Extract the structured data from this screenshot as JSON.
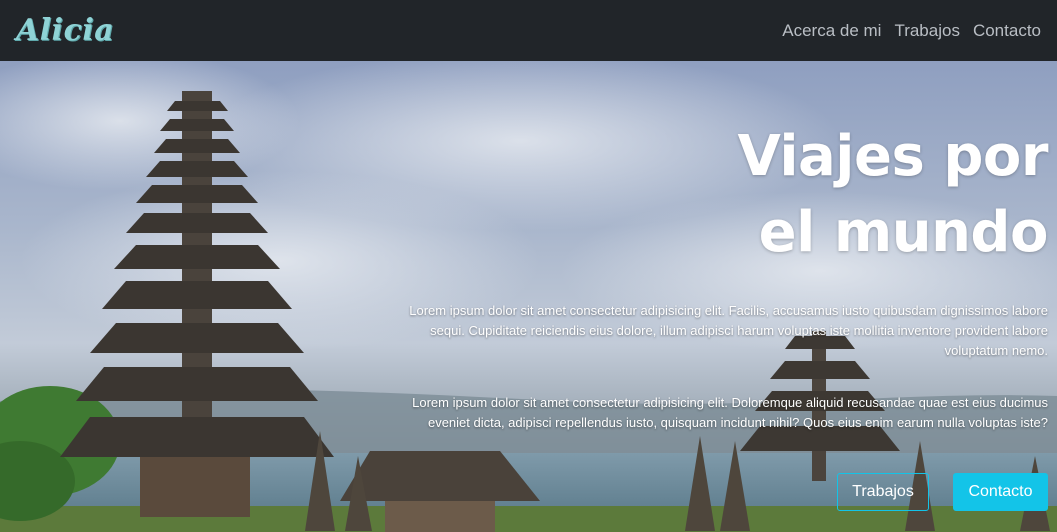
{
  "brand": {
    "logo_text": "Alicia"
  },
  "nav": {
    "items": [
      {
        "label": "Acerca de mi"
      },
      {
        "label": "Trabajos"
      },
      {
        "label": "Contacto"
      }
    ]
  },
  "hero": {
    "title_line1": "Viajes por",
    "title_line2": "el mundo",
    "paragraph1": "Lorem ipsum dolor sit amet consectetur adipisicing elit. Facilis, accusamus iusto quibusdam dignissimos labore sequi. Cupiditate reiciendis eius dolore, illum adipisci harum voluptas iste mollitia inventore provident labore voluptatum nemo.",
    "paragraph2": "Lorem ipsum dolor sit amet consectetur adipisicing elit. Doloremque aliquid recusandae quae est eius ducimus eveniet dicta, adipisci repellendus iusto, quisquam incidunt nihil? Quos eius enim earum nulla voluptas iste?",
    "buttons": {
      "works_label": "Trabajos",
      "contact_label": "Contacto"
    }
  },
  "colors": {
    "navbar_bg": "#212529",
    "logo": "#8fd3d6",
    "nav_link": "#b9bec4",
    "accent": "#13c4e8",
    "hero_text": "#ffffff"
  }
}
